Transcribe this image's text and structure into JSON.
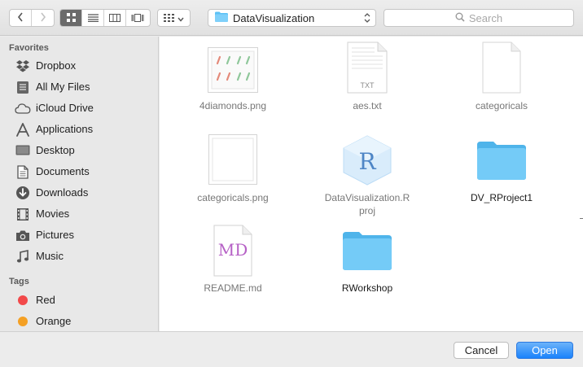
{
  "toolbar": {
    "path_label": "DataVisualization",
    "search_placeholder": "Search"
  },
  "sidebar": {
    "favorites_heading": "Favorites",
    "favorites": [
      {
        "label": "Dropbox",
        "icon": "dropbox-icon"
      },
      {
        "label": "All My Files",
        "icon": "all-files-icon"
      },
      {
        "label": "iCloud Drive",
        "icon": "cloud-icon"
      },
      {
        "label": "Applications",
        "icon": "applications-icon"
      },
      {
        "label": "Desktop",
        "icon": "desktop-icon"
      },
      {
        "label": "Documents",
        "icon": "documents-icon"
      },
      {
        "label": "Downloads",
        "icon": "downloads-icon"
      },
      {
        "label": "Movies",
        "icon": "movies-icon"
      },
      {
        "label": "Pictures",
        "icon": "camera-icon"
      },
      {
        "label": "Music",
        "icon": "music-icon"
      }
    ],
    "tags_heading": "Tags",
    "tags": [
      {
        "label": "Red",
        "color": "#f2494a"
      },
      {
        "label": "Orange",
        "color": "#f4a024"
      }
    ]
  },
  "files": [
    {
      "name": "4diamonds.png",
      "kind": "image"
    },
    {
      "name": "aes.txt",
      "kind": "text",
      "badge": "TXT"
    },
    {
      "name": "categoricals",
      "kind": "blank"
    },
    {
      "name": "categoricals.png",
      "kind": "image-blank"
    },
    {
      "name_line1": "DataVisualization.R",
      "name_line2": "proj",
      "kind": "rproj",
      "badge": "R"
    },
    {
      "name": "DV_RProject1",
      "kind": "folder"
    },
    {
      "name": "README.md",
      "kind": "markdown",
      "badge": "MD"
    },
    {
      "name": "RWorkshop",
      "kind": "folder"
    }
  ],
  "buttons": {
    "cancel": "Cancel",
    "open": "Open"
  },
  "colors": {
    "folder": "#5cc1f5",
    "accent": "#1a82fb"
  }
}
